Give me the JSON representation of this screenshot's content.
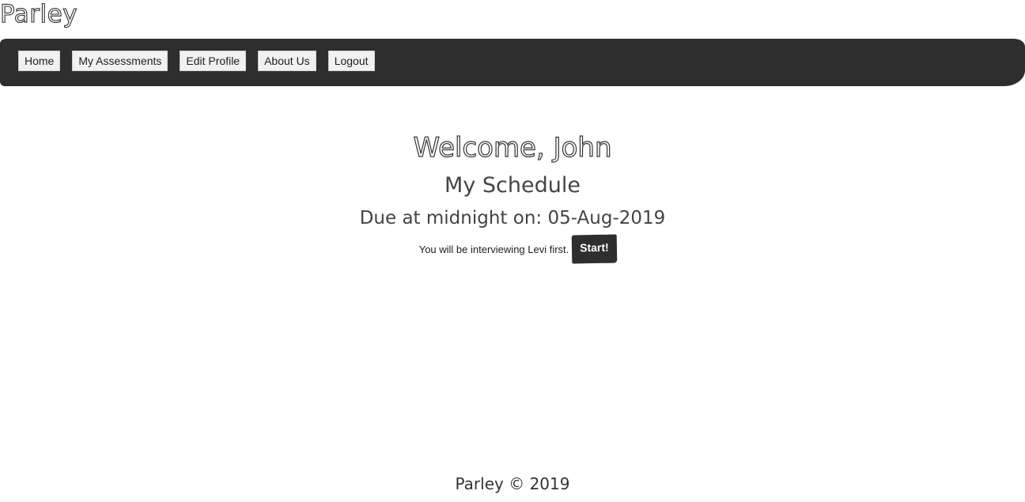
{
  "brand": "Parley",
  "nav": {
    "items": [
      {
        "label": "Home"
      },
      {
        "label": "My Assessments"
      },
      {
        "label": "Edit Profile"
      },
      {
        "label": "About Us"
      },
      {
        "label": "Logout"
      }
    ]
  },
  "main": {
    "welcome": "Welcome, John",
    "schedule_title": "My Schedule",
    "due_text": "Due at midnight on: 05-Aug-2019",
    "interview_text": "You will be interviewing Levi first.",
    "start_label": "Start!"
  },
  "footer": {
    "text": "Parley © 2019"
  },
  "colors": {
    "navbar_bg": "#2e2e2e",
    "button_bg": "#f1f1f1",
    "start_bg": "#2e2e2e",
    "page_bg": "#ffffff"
  }
}
